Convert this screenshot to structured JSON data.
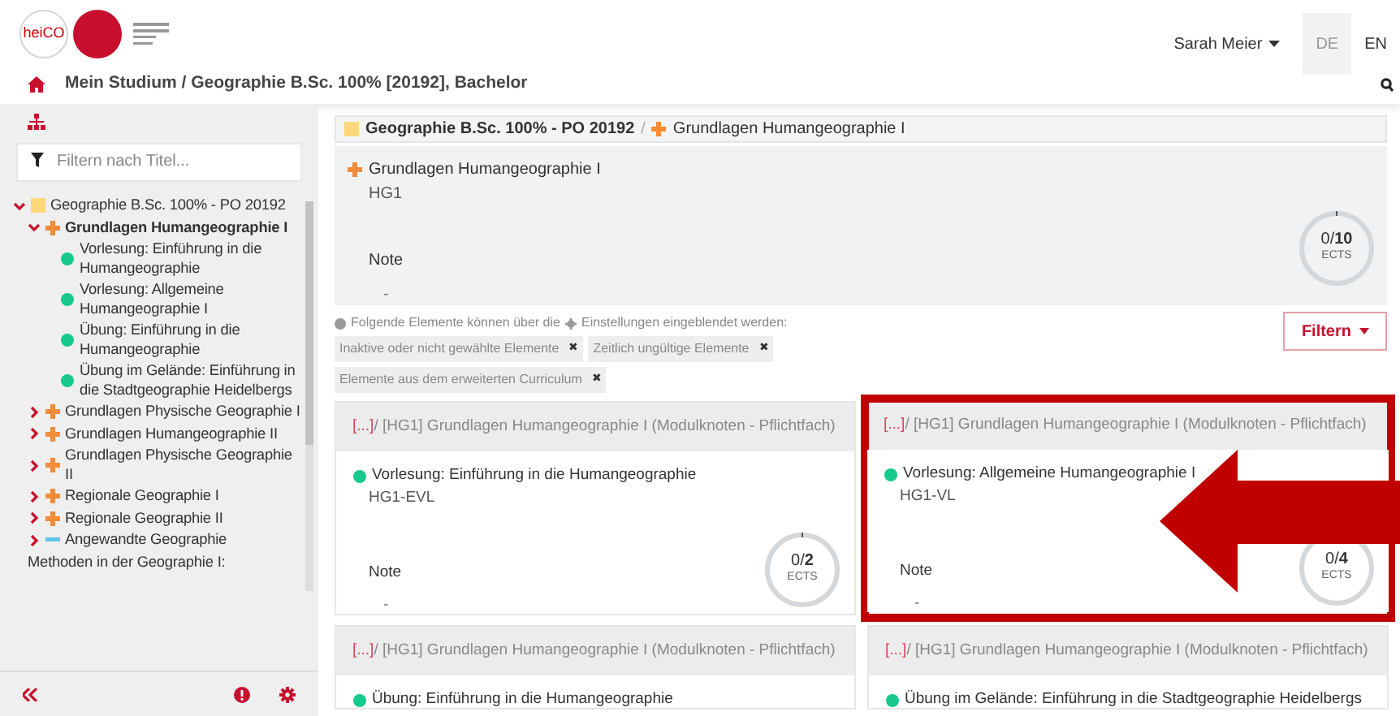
{
  "header": {
    "logo_text": "heiCO",
    "user": "Sarah Meier",
    "languages": [
      {
        "label": "DE",
        "selected": true
      },
      {
        "label": "EN",
        "selected": false
      }
    ]
  },
  "breadcrumb": "Mein Studium / Geographie B.Sc. 100% [20192], Bachelor",
  "sidebar": {
    "filter_placeholder": "Filtern nach Titel...",
    "tree": [
      {
        "label": "Geographie B.Sc. 100% - PO 20192",
        "kind": "program",
        "expanded": true,
        "selected": false,
        "children": [
          {
            "label": "Grundlagen Humangeographie I",
            "kind": "module",
            "expanded": true,
            "selected": true,
            "children": [
              {
                "label": "Vorlesung: Einführung in die Humangeographie",
                "kind": "course",
                "selected": false
              },
              {
                "label": "Vorlesung: Allgemeine Humangeographie I",
                "kind": "course",
                "selected": false
              },
              {
                "label": "Übung: Einführung in die Humangeographie",
                "kind": "course",
                "selected": false
              },
              {
                "label": "Übung im Gelände: Einführung in die Stadtgeographie Heidelbergs",
                "kind": "course",
                "selected": false
              }
            ]
          },
          {
            "label": "Grundlagen Physische Geographie I",
            "kind": "module",
            "expanded": false,
            "selected": false
          },
          {
            "label": "Grundlagen Humangeographie II",
            "kind": "module",
            "expanded": false,
            "selected": false
          },
          {
            "label": "Grundlagen Physische Geographie II",
            "kind": "module",
            "expanded": false,
            "selected": false
          },
          {
            "label": "Regionale Geographie I",
            "kind": "module",
            "expanded": false,
            "selected": false
          },
          {
            "label": "Regionale Geographie II",
            "kind": "module",
            "expanded": false,
            "selected": false
          },
          {
            "label": "Angewandte Geographie",
            "kind": "group",
            "expanded": false,
            "selected": false
          },
          {
            "label": "Methoden in der Geographie I:",
            "kind": "none",
            "selected": false
          }
        ]
      }
    ]
  },
  "path_separator": "/",
  "path": [
    {
      "label": "Geographie B.Sc. 100% - PO 20192",
      "kind": "program"
    },
    {
      "label": "Grundlagen Humangeographie I",
      "kind": "module"
    }
  ],
  "module": {
    "title": "Grundlagen Humangeographie I",
    "code": "HG1",
    "grade_label": "Note",
    "grade": "-",
    "ects": "0",
    "ects_separator": "/",
    "ects_total": "10",
    "ects_unit": "ECTS"
  },
  "hint": {
    "text": "Folgende Elemente können über die",
    "text_after": "Einstellungen eingeblendet werden:",
    "chips": [
      "Inaktive oder nicht gewählte Elemente",
      "Zeitlich ungültige Elemente",
      "Elemente aus dem erweiterten Curriculum"
    ],
    "chip_close": "✖"
  },
  "filter_button": "Filtern",
  "cards": [
    {
      "ellipsis": "[...]",
      "path": " / [HG1] Grundlagen Humangeographie I (Modulknoten - Pflichtfach)",
      "title": "Vorlesung: Einführung in die Humangeographie",
      "code": "HG1-EVL",
      "grade_label": "Note",
      "grade": "-",
      "ects": "0",
      "ects_separator": "/",
      "ects_total": "2",
      "ects_unit": "ECTS",
      "highlighted": false
    },
    {
      "ellipsis": "[...]",
      "path": " / [HG1] Grundlagen Humangeographie I (Modulknoten - Pflichtfach)",
      "title": "Vorlesung: Allgemeine Humangeographie I",
      "code": "HG1-VL",
      "grade_label": "Note",
      "grade": "-",
      "ects": "0",
      "ects_separator": "/",
      "ects_total": "4",
      "ects_unit": "ECTS",
      "highlighted": true
    },
    {
      "ellipsis": "[...]",
      "path": " / [HG1] Grundlagen Humangeographie I (Modulknoten - Pflichtfach)",
      "title": "Übung: Einführung in die Humangeographie",
      "highlighted": false
    },
    {
      "ellipsis": "[...]",
      "path": " / [HG1] Grundlagen Humangeographie I (Modulknoten - Pflichtfach)",
      "title": "Übung im Gelände: Einführung in die Stadtgeographie Heidelbergs",
      "highlighted": false
    }
  ]
}
